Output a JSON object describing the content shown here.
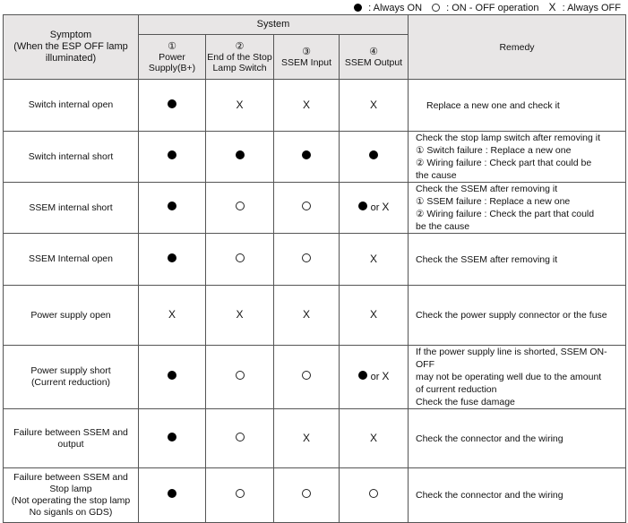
{
  "legend": {
    "on_label": ": Always ON",
    "onoff_label": ": ON - OFF operation",
    "off_symbol": "X",
    "off_label": ": Always OFF"
  },
  "header": {
    "symptom": "Symptom",
    "symptom_sub1": "(When the ESP OFF lamp",
    "symptom_sub2": "illuminated)",
    "system": "System",
    "remedy": "Remedy",
    "columns": [
      {
        "num": "①",
        "label1": "Power Supply(B+)",
        "label2": ""
      },
      {
        "num": "②",
        "label1": "End of the Stop",
        "label2": "Lamp Switch"
      },
      {
        "num": "③",
        "label1": "SSEM Input",
        "label2": ""
      },
      {
        "num": "④",
        "label1": "SSEM Output",
        "label2": ""
      }
    ]
  },
  "symbols": {
    "x": "X",
    "or": "or"
  },
  "rows": [
    {
      "symptom": [
        "Switch internal open"
      ],
      "states": [
        "on",
        "off",
        "off",
        "off"
      ],
      "remedy": [
        "Replace a new one and check it"
      ],
      "indent": true
    },
    {
      "symptom": [
        "Switch internal short"
      ],
      "states": [
        "on",
        "on",
        "on",
        "on"
      ],
      "remedy": [
        "Check the stop lamp switch after removing it",
        "① Switch failure : Replace a new one",
        "② Wiring failure : Check part that could be",
        "the cause"
      ],
      "indent": false
    },
    {
      "symptom": [
        "SSEM internal short"
      ],
      "states": [
        "on",
        "onoff",
        "onoff",
        "on-or-off"
      ],
      "remedy": [
        "Check the SSEM after removing it",
        "① SSEM failure : Replace a new one",
        "② Wiring failure : Check the part that could",
        "be the cause"
      ],
      "indent": false
    },
    {
      "symptom": [
        "SSEM Internal open"
      ],
      "states": [
        "on",
        "onoff",
        "onoff",
        "off"
      ],
      "remedy": [
        "Check the SSEM after removing it"
      ],
      "indent": false
    },
    {
      "symptom": [
        "Power supply open"
      ],
      "states": [
        "off",
        "off",
        "off",
        "off"
      ],
      "remedy": [
        "Check the power supply connector or the fuse"
      ],
      "indent": false
    },
    {
      "symptom": [
        "Power supply short",
        "(Current reduction)"
      ],
      "states": [
        "on",
        "onoff",
        "onoff",
        "on-or-off"
      ],
      "remedy": [
        "If the power supply line is shorted, SSEM ON-OFF",
        "may not be operating well due to the amount",
        "of current reduction",
        "Check the fuse damage"
      ],
      "indent": false
    },
    {
      "symptom": [
        "Failure between SSEM and",
        "output"
      ],
      "states": [
        "on",
        "onoff",
        "off",
        "off"
      ],
      "remedy": [
        "Check the connector and the wiring"
      ],
      "indent": false
    },
    {
      "symptom": [
        "Failure between SSEM and",
        "Stop lamp",
        "(Not operating the stop lamp",
        "No siganls on GDS)"
      ],
      "states": [
        "on",
        "onoff",
        "onoff",
        "onoff"
      ],
      "remedy": [
        "Check the connector and the wiring"
      ],
      "indent": false
    }
  ]
}
